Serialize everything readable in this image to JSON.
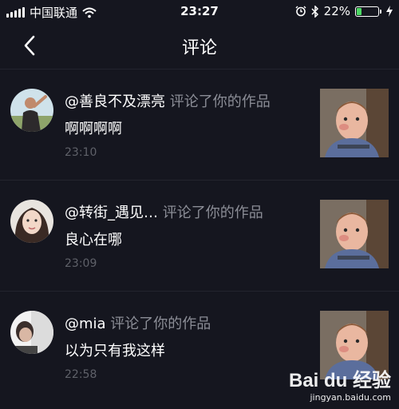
{
  "status_bar": {
    "carrier": "中国联通",
    "time": "23:27",
    "battery_percent": "22%",
    "battery_level": 0.22,
    "icons": [
      "signal-bars-icon",
      "wifi-icon",
      "alarm-icon",
      "bluetooth-icon",
      "battery-icon",
      "charging-icon"
    ]
  },
  "nav": {
    "title": "评论",
    "back_icon": "chevron-left-icon"
  },
  "comments": [
    {
      "username": "@善良不及漂亮",
      "action": " 评论了你的作品",
      "content": "啊啊啊啊",
      "time": "23:10"
    },
    {
      "username": "@转街_遇见…",
      "action": "  评论了你的作品",
      "content": "良心在哪",
      "time": "23:09"
    },
    {
      "username": "@mia",
      "action": " 评论了你的作品",
      "content": "以为只有我这样",
      "time": "22:58"
    }
  ],
  "watermark": {
    "logo": "Bai du 经验",
    "url": "jingyan.baidu.com"
  },
  "colors": {
    "background": "#15161f",
    "secondary_text": "#8b8d96",
    "time_text": "#5f6169",
    "battery_fill": "#4cd964"
  }
}
